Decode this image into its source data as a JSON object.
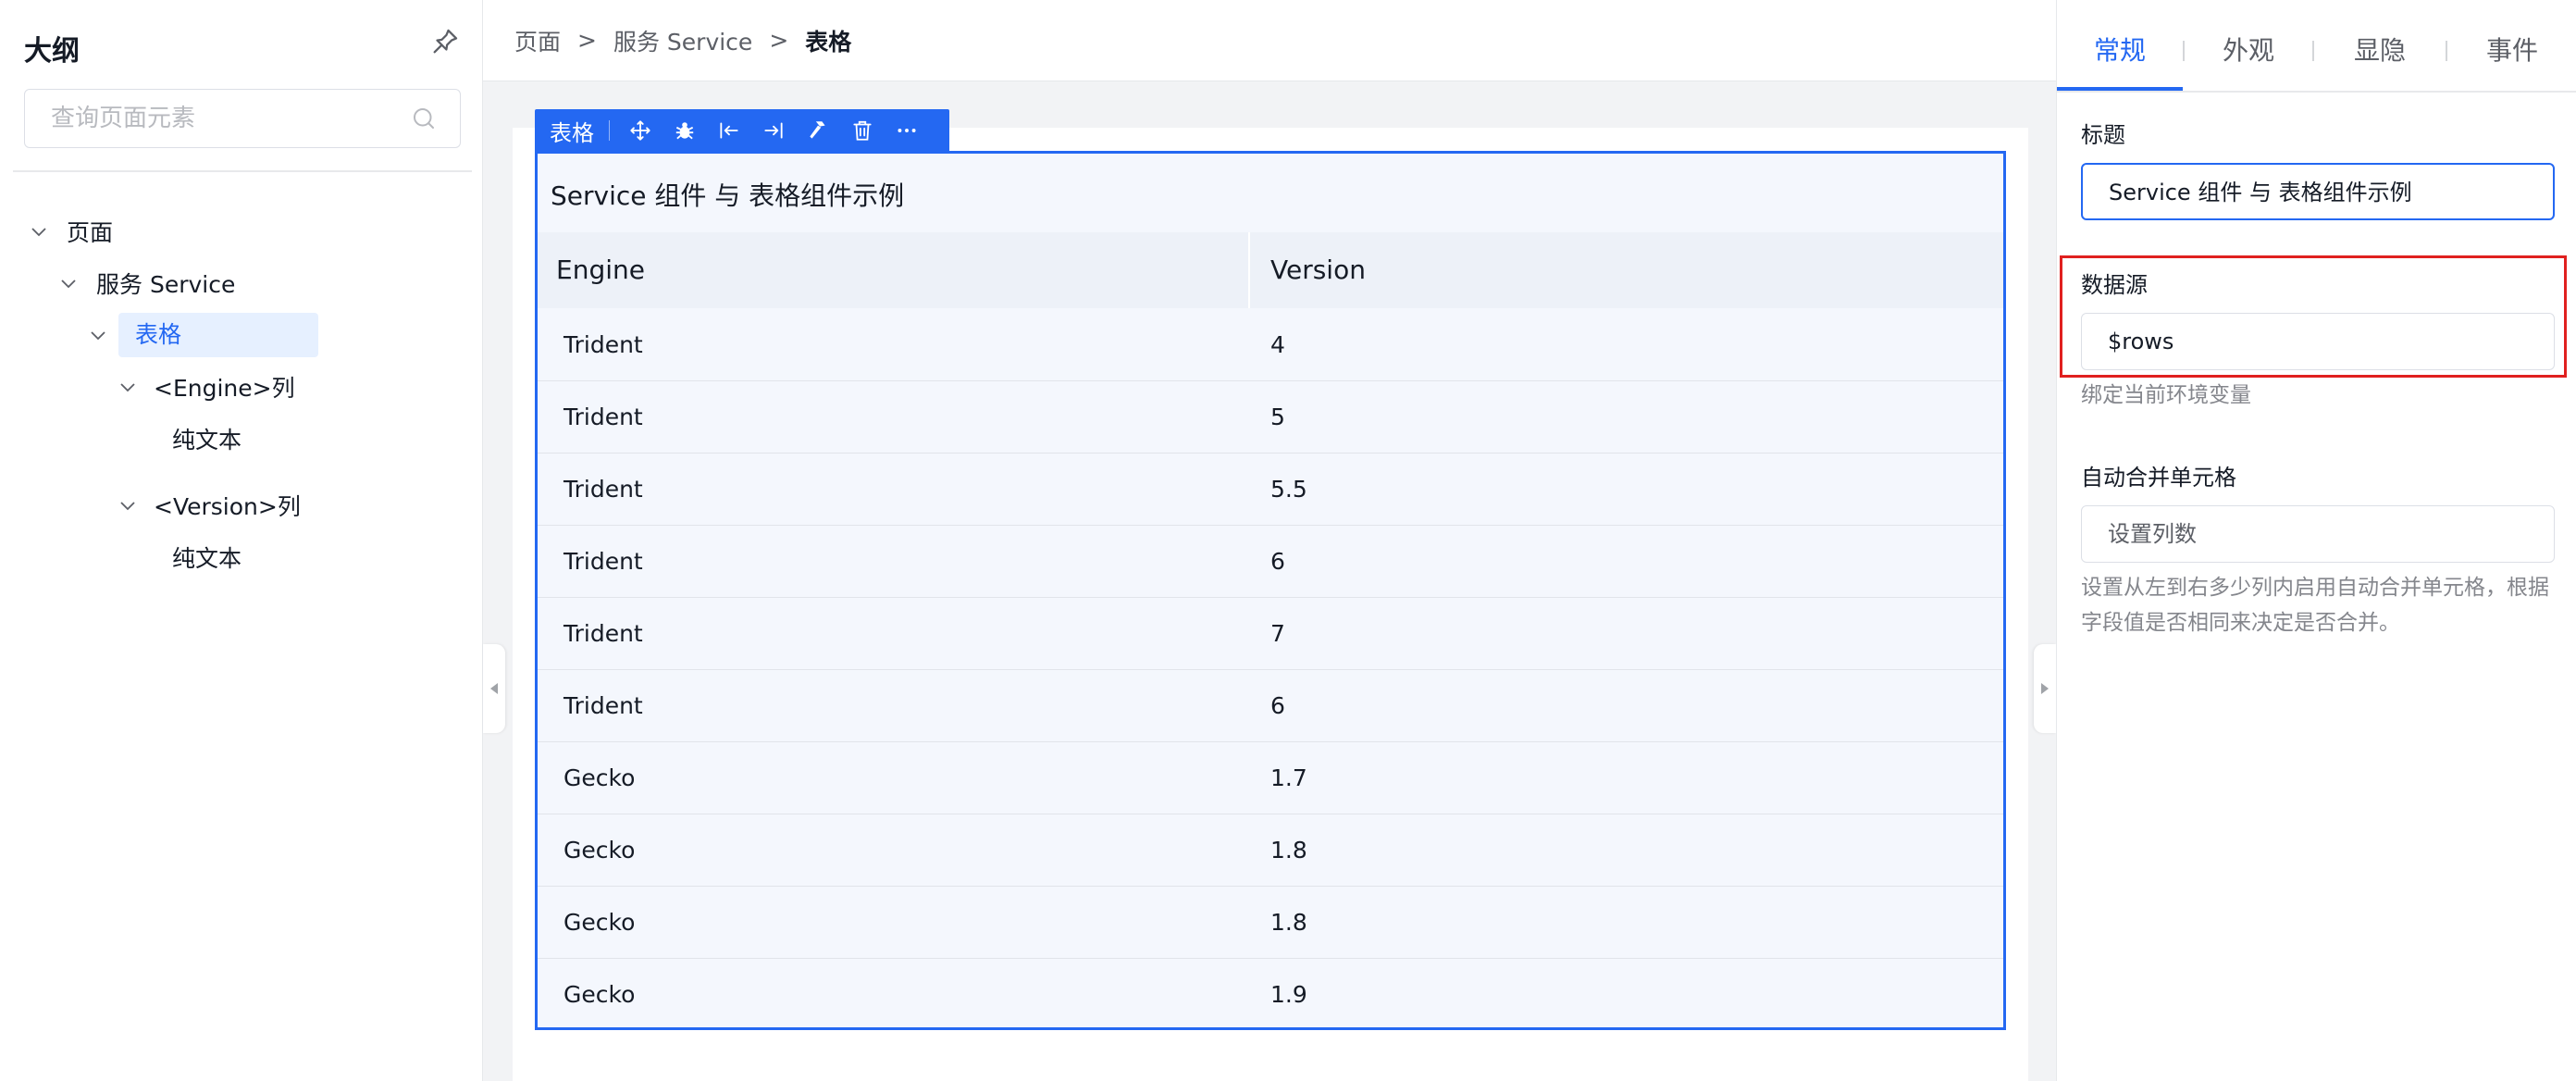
{
  "outline": {
    "title": "大纲",
    "search_placeholder": "查询页面元素",
    "tree": {
      "page": "页面",
      "service": "服务 Service",
      "table": "表格",
      "engine_col": "<Engine>列",
      "engine_text": "纯文本",
      "version_col": "<Version>列",
      "version_text": "纯文本"
    }
  },
  "breadcrumb": {
    "items": [
      "页面",
      "服务 Service",
      "表格"
    ],
    "separator": ">"
  },
  "toolbar": {
    "label": "表格",
    "icons": [
      "move-icon",
      "debug-icon",
      "insert-before-icon",
      "insert-after-icon",
      "hammer-icon",
      "delete-icon",
      "more-icon"
    ]
  },
  "table": {
    "title": "Service 组件 与 表格组件示例",
    "columns": [
      "Engine",
      "Version"
    ],
    "rows": [
      [
        "Trident",
        "4"
      ],
      [
        "Trident",
        "5"
      ],
      [
        "Trident",
        "5.5"
      ],
      [
        "Trident",
        "6"
      ],
      [
        "Trident",
        "7"
      ],
      [
        "Trident",
        "6"
      ],
      [
        "Gecko",
        "1.7"
      ],
      [
        "Gecko",
        "1.8"
      ],
      [
        "Gecko",
        "1.8"
      ],
      [
        "Gecko",
        "1.9"
      ]
    ]
  },
  "props": {
    "tabs": [
      "常规",
      "外观",
      "显隐",
      "事件"
    ],
    "active_tab": "常规",
    "title_label": "标题",
    "title_value": "Service 组件 与 表格组件示例",
    "source_label": "数据源",
    "source_value": "$rows",
    "source_help": "绑定当前环境变量",
    "merge_label": "自动合并单元格",
    "merge_placeholder": "设置列数",
    "merge_help": "设置从左到右多少列内启用自动合并单元格，根据字段值是否相同来决定是否合并。"
  },
  "colors": {
    "accent": "#2468f2",
    "highlight_border": "#e0201f",
    "selected_bg": "#e6f0ff"
  }
}
